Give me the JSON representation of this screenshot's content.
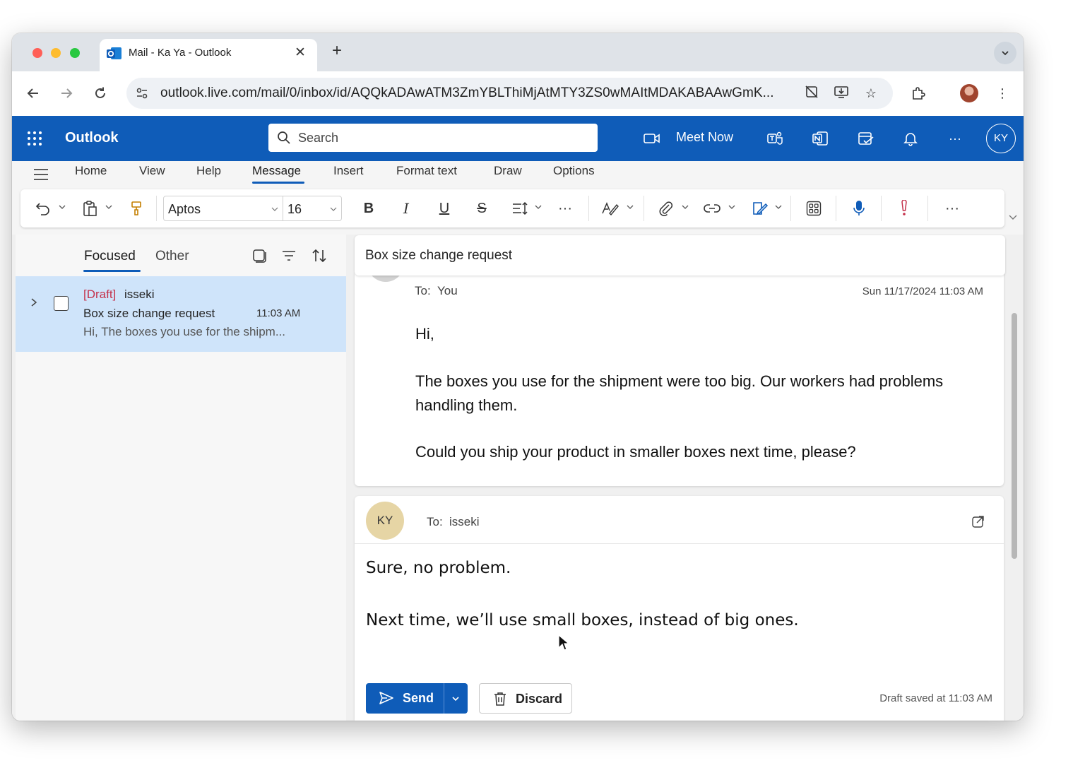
{
  "browser": {
    "tab_title": "Mail - Ka Ya - Outlook",
    "url": "outlook.live.com/mail/0/inbox/id/AQQkADAwATM3ZmYBLThiMjAtMTY3ZS0wMAItMDAKABAAwGmK..."
  },
  "header": {
    "brand": "Outlook",
    "search_placeholder": "Search",
    "meet_now": "Meet Now",
    "user_initials": "KY",
    "brand_color": "#0f5cb8"
  },
  "ribbon": {
    "tabs": [
      "Home",
      "View",
      "Help",
      "Message",
      "Insert",
      "Format text",
      "Draw",
      "Options"
    ],
    "active_tab": "Message",
    "font_name": "Aptos",
    "font_size": "16"
  },
  "maillist": {
    "tabs": [
      "Focused",
      "Other"
    ],
    "active_tab": "Focused",
    "items": [
      {
        "draft_tag": "[Draft]",
        "sender": "isseki",
        "subject": "Box size change request",
        "time": "11:03 AM",
        "preview": "Hi, The boxes you use for the shipm..."
      }
    ]
  },
  "reading": {
    "subject": "Box size change request",
    "message": {
      "to_label": "To:",
      "to_name": "You",
      "date": "Sun 11/17/2024 11:03 AM",
      "greeting": "Hi,",
      "paragraph1": "The boxes you use for the shipment were too big. Our workers had problems handling them.",
      "paragraph2": "Could you ship your product in smaller boxes next time, please?"
    },
    "reply": {
      "avatar_initials": "KY",
      "to_label": "To:",
      "to_name": "isseki",
      "line1": "Sure, no problem.",
      "line2": "Next time, we’ll use small boxes, instead of big ones.",
      "send_label": "Send",
      "discard_label": "Discard",
      "draft_status": "Draft saved at 11:03 AM"
    }
  }
}
